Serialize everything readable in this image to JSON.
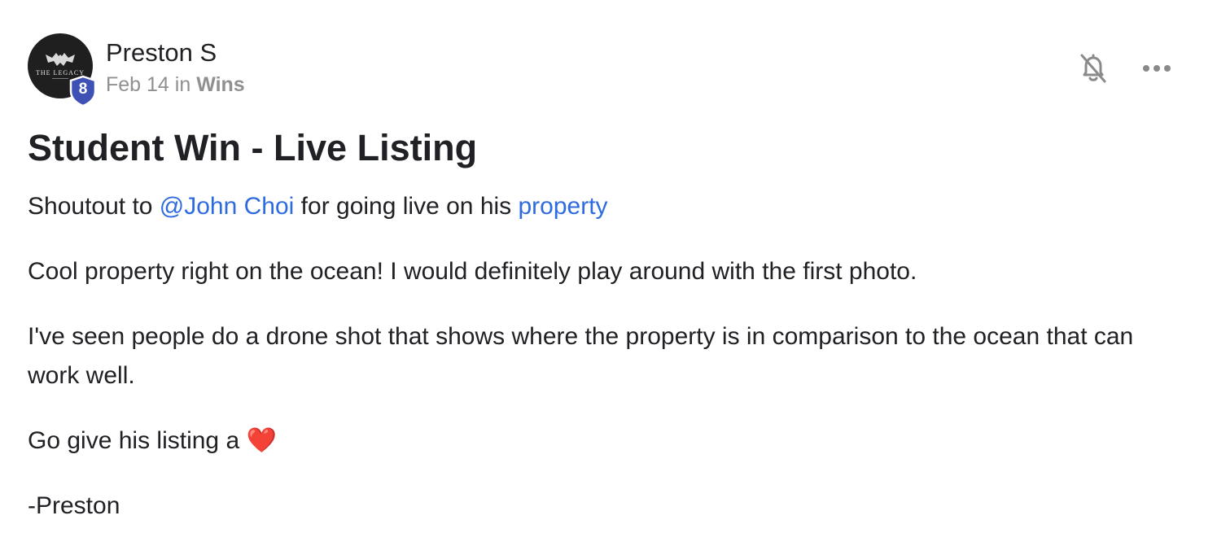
{
  "author": {
    "name": "Preston S",
    "level": "8",
    "avatar_text": "THE LEGACY"
  },
  "meta": {
    "date": "Feb 14",
    "in_word": "in",
    "category": "Wins"
  },
  "actions": {
    "bell_icon": "bell-off-icon",
    "more_icon": "more-horizontal-icon"
  },
  "post": {
    "title": "Student Win - Live Listing",
    "p1_before": "Shoutout to ",
    "mention": "@John Choi",
    "p1_middle": " for going live on his ",
    "p1_link": "property",
    "p2": "Cool property right on the ocean! I would definitely play around with the first photo.",
    "p3": "I've seen people do a drone shot that shows where the property is in comparison to the ocean that can work well.",
    "p4": "Go give his listing a ",
    "heart": "❤️",
    "signature": "-Preston"
  },
  "colors": {
    "link": "#2e6bde",
    "badge": "#3f51b5",
    "muted": "#909090"
  }
}
